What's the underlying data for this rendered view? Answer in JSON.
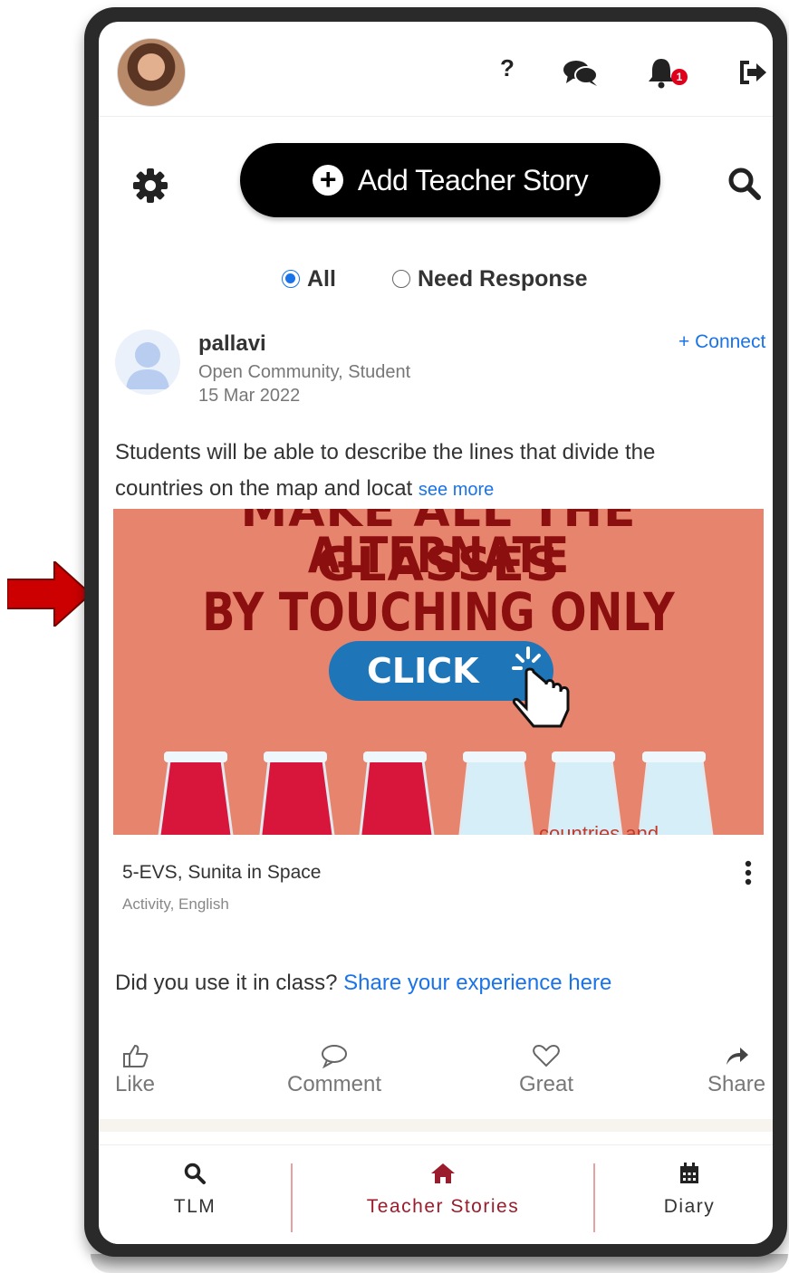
{
  "colors": {
    "accent": "#1a73e8",
    "active_nav": "#9b1c2c",
    "pointer_arrow": "#cc0000",
    "media_bg": "#e7846d"
  },
  "topbar": {
    "icons": [
      "user-avatar",
      "help-icon",
      "chat-icon",
      "bell-icon",
      "logout-icon"
    ],
    "help_label": "?",
    "notification_count": "1"
  },
  "actions_row": {
    "add_story_label": "Add Teacher Story"
  },
  "filters": {
    "options": [
      {
        "label": "All",
        "checked": true
      },
      {
        "label": "Need Response",
        "checked": false
      }
    ]
  },
  "post": {
    "author": "pallavi",
    "role": "Open Community, Student",
    "date": "15 Mar 2022",
    "connect_label": "+ Connect",
    "text": "Students will be able to describe the lines that divide the countries on the map and locat",
    "see_more_label": "see more",
    "media": {
      "cut_line": "MAKE ALL THE GLASSES",
      "line1": "ALTERNATE",
      "line2": "BY TOUCHING ONLY ONE",
      "button_label": "CLICK",
      "bottom_text": "countries and"
    },
    "resource_title": "5-EVS, Sunita in Space",
    "resource_meta": "Activity, English",
    "experience_prompt": "Did you use it in class?",
    "experience_link": "Share your experience here",
    "actions": {
      "like": "Like",
      "comment": "Comment",
      "great": "Great",
      "share": "Share"
    }
  },
  "bottom_nav": {
    "tlm": "TLM",
    "stories": "Teacher Stories",
    "diary": "Diary",
    "active": "Teacher Stories"
  }
}
